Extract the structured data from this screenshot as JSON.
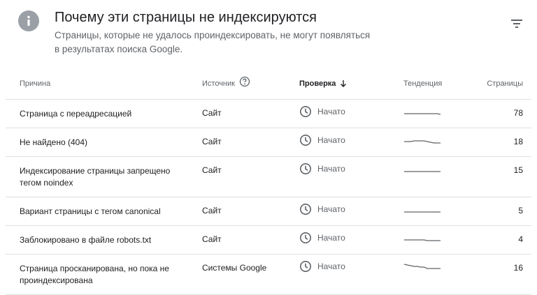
{
  "header": {
    "title": "Почему эти страницы не индексируются",
    "subtitle": "Страницы, которые не удалось проиндексировать, не могут появляться в результатах поиска Google."
  },
  "table": {
    "columns": {
      "reason": "Причина",
      "source": "Источник",
      "check": "Проверка",
      "trend": "Тенденция",
      "pages": "Страницы"
    },
    "sorted_by": "check",
    "sort_direction": "descending",
    "rows": [
      {
        "reason": "Страница с переадресацией",
        "source": "Сайт",
        "status": "Начато",
        "pages": "78",
        "trend": [
          10,
          10,
          10,
          10,
          10,
          10,
          10,
          10,
          10,
          10,
          10,
          11
        ]
      },
      {
        "reason": "Не найдено (404)",
        "source": "Сайт",
        "status": "Начато",
        "pages": "18",
        "trend": [
          9,
          9,
          9,
          8,
          8,
          8,
          8,
          9,
          10,
          11,
          11,
          11
        ]
      },
      {
        "reason": "Индексирование страницы запрещено тегом noindex",
        "source": "Сайт",
        "status": "Начато",
        "pages": "15",
        "trend": [
          11,
          11,
          11,
          11,
          11,
          11,
          11,
          11,
          11,
          11,
          11,
          11
        ]
      },
      {
        "reason": "Вариант страницы с тегом canonical",
        "source": "Сайт",
        "status": "Начато",
        "pages": "5",
        "trend": [
          11,
          11,
          11,
          11,
          11,
          11,
          11,
          11,
          11,
          11,
          11,
          11
        ]
      },
      {
        "reason": "Заблокировано в файле robots.txt",
        "source": "Сайт",
        "status": "Начато",
        "pages": "4",
        "trend": [
          10,
          10,
          10,
          10,
          10,
          10,
          10,
          11,
          11,
          11,
          11,
          11
        ]
      },
      {
        "reason": "Страница просканирована, но пока не проиндексирована",
        "source": "Системы Google",
        "status": "Начато",
        "pages": "16",
        "trend": [
          4,
          5,
          6,
          7,
          7,
          8,
          8,
          10,
          10,
          10,
          10,
          10
        ]
      }
    ]
  },
  "colors": {
    "info_icon_bg": "#9aa0a6",
    "divider": "#e0e0e0",
    "muted_text": "#5f6368",
    "trend_line": "#5f6368"
  },
  "icons": {
    "info": "info-icon",
    "filter": "filter-icon",
    "help": "help-icon",
    "sort": "arrow-down-icon",
    "status": "clock-icon"
  }
}
